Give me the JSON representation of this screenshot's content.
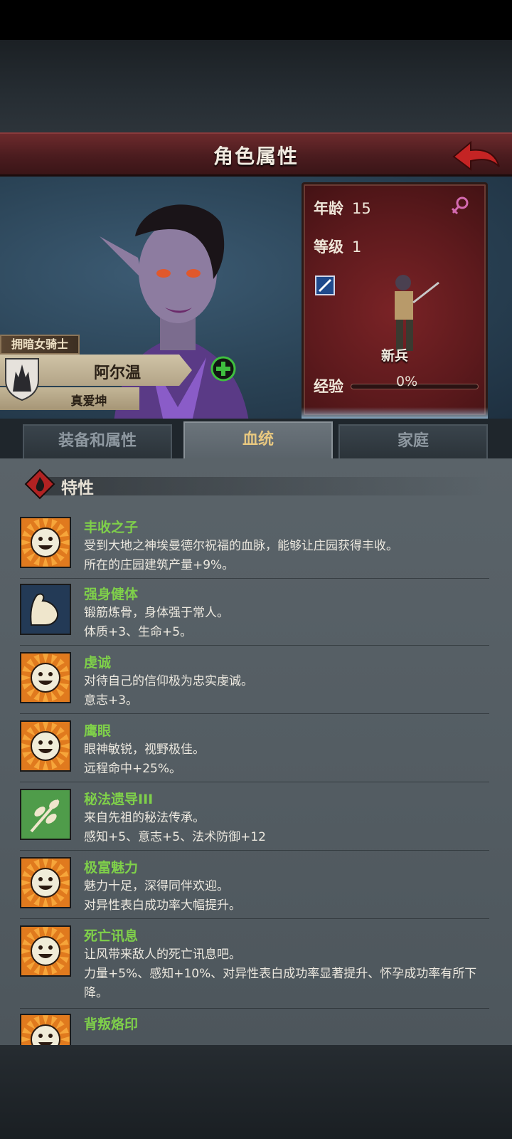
{
  "header": {
    "title": "角色属性",
    "back_icon": "back-arrow-icon"
  },
  "character": {
    "title_tag": "拥暗女骑士",
    "name": "阿尔温",
    "subtitle": "真爱坤",
    "age_label": "年龄",
    "age": "15",
    "gender_icon": "female-icon",
    "level_label": "等级",
    "level": "1",
    "unit": "新兵",
    "exp_label": "经验",
    "exp": "0%",
    "exp_fraction": 0
  },
  "tabs": [
    {
      "label": "装备和属性",
      "active": false
    },
    {
      "label": "血统",
      "active": true
    },
    {
      "label": "家庭",
      "active": false
    }
  ],
  "traits_section": {
    "title": "特性"
  },
  "traits": [
    {
      "name": "丰收之子",
      "icon": "smiley-sun-icon",
      "desc": [
        "受到大地之神埃曼德尔祝福的血脉，能够让庄园获得丰收。",
        "所在的庄园建筑产量+9%。"
      ]
    },
    {
      "name": "强身健体",
      "icon": "flexed-arm-icon",
      "desc": [
        "锻筋炼骨，身体强于常人。",
        "体质+3、生命+5。"
      ]
    },
    {
      "name": "虔诚",
      "icon": "smiley-sun-icon",
      "desc": [
        "对待自己的信仰极为忠实虔诚。",
        "意志+3。"
      ]
    },
    {
      "name": "鹰眼",
      "icon": "smiley-sun-icon",
      "desc": [
        "眼神敏锐，视野极佳。",
        "远程命中+25%。"
      ]
    },
    {
      "name": "秘法遗导III",
      "icon": "herb-branch-icon",
      "desc": [
        "来自先祖的秘法传承。",
        "感知+5、意志+5、法术防御+12"
      ]
    },
    {
      "name": "极富魅力",
      "icon": "smiley-sun-icon",
      "desc": [
        "魅力十足，深得同伴欢迎。",
        "对异性表白成功率大幅提升。"
      ]
    },
    {
      "name": "死亡讯息",
      "icon": "smiley-sun-icon",
      "desc": [
        "让风带来敌人的死亡讯息吧。",
        "力量+5%、感知+10%、对异性表白成功率显著提升、怀孕成功率有所下降。"
      ]
    },
    {
      "name": "背叛烙印",
      "icon": "smiley-sun-icon",
      "desc": []
    }
  ]
}
